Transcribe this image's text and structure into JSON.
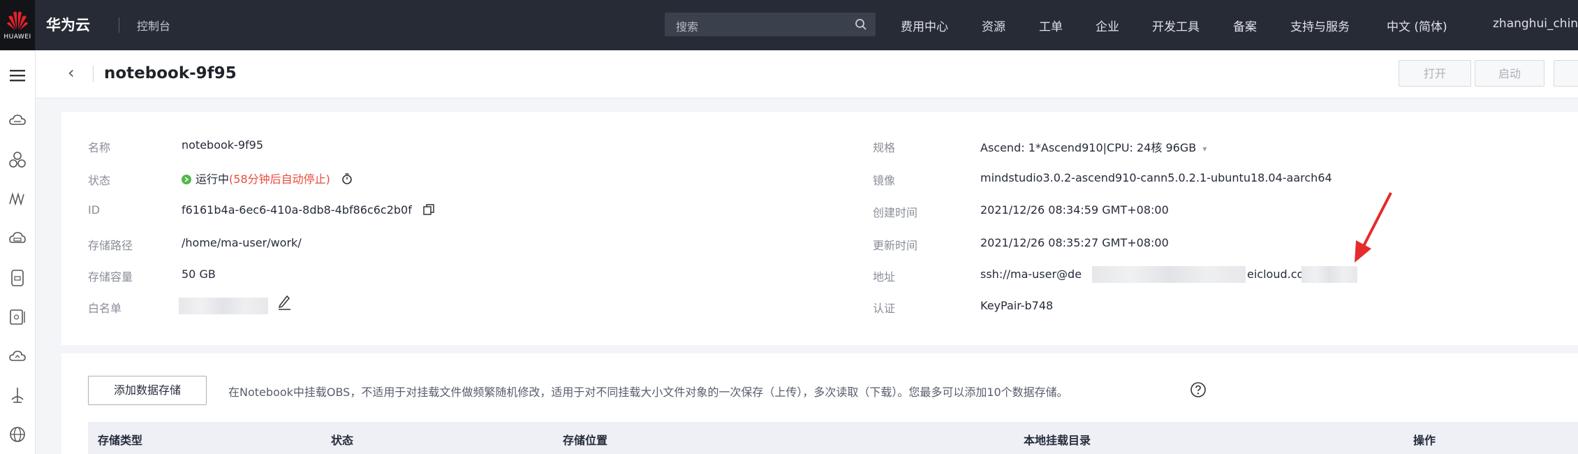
{
  "topbar": {
    "logo_text": "HUAWEI",
    "brand": "华为云",
    "console": "控制台",
    "search_placeholder": "搜索",
    "nav": [
      "费用中心",
      "资源",
      "工单",
      "企业",
      "开发工具",
      "备案",
      "支持与服务",
      "中文 (简体)",
      "zhanghui_china"
    ]
  },
  "header": {
    "title": "notebook-9f95",
    "buttons": [
      "打开",
      "启动"
    ]
  },
  "details": {
    "left": [
      {
        "label": "名称",
        "value": "notebook-9f95"
      },
      {
        "label": "状态",
        "status": "运行中",
        "auto_stop": "(58分钟后自动停止)"
      },
      {
        "label": "ID",
        "value": "f6161b4a-6ec6-410a-8db8-4bf86c6c2b0f"
      },
      {
        "label": "存储路径",
        "value": "/home/ma-user/work/"
      },
      {
        "label": "存储容量",
        "value": "50 GB"
      },
      {
        "label": "白名单",
        "value": ""
      }
    ],
    "right": [
      {
        "label": "规格",
        "value": "Ascend: 1*Ascend910|CPU: 24核 96GB"
      },
      {
        "label": "镜像",
        "value": "mindstudio3.0.2-ascend910-cann5.0.2.1-ubuntu18.04-aarch64"
      },
      {
        "label": "创建时间",
        "value": "2021/12/26 08:34:59 GMT+08:00"
      },
      {
        "label": "更新时间",
        "value": "2021/12/26 08:35:27 GMT+08:00"
      },
      {
        "label": "地址",
        "value_prefix": "ssh://ma-user@de",
        "value_suffix": "eicloud.co"
      },
      {
        "label": "认证",
        "value": "KeyPair-b748"
      }
    ]
  },
  "storage": {
    "add_button": "添加数据存储",
    "note": "在Notebook中挂载OBS，不适用于对挂载文件做频繁随机修改，适用于对不同挂载大小文件对象的一次保存（上传），多次读取（下载）。您最多可以添加10个数据存储。",
    "columns": [
      "存储类型",
      "状态",
      "存储位置",
      "本地挂载目录",
      "操作"
    ]
  },
  "colors": {
    "topbar": "#262b35",
    "accent_red": "#e84c3d",
    "status_green": "#50b849"
  }
}
